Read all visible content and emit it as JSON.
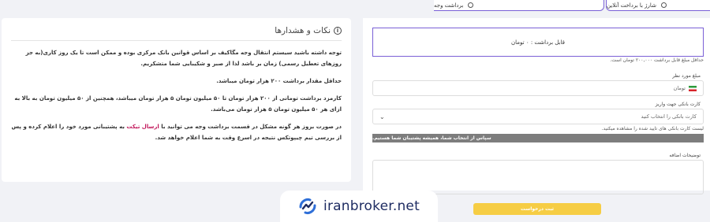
{
  "tabs": {
    "online": "شارژ با برداخت آنلاین",
    "cash": "برداشت وجه"
  },
  "notes": {
    "title": "نکات و هشدارها",
    "p1": "توجه داشته باشید سیستم انتقال وجه مگاکیف بر اساس قوانین بانک مرکزی بوده و ممکن است تا یک روز کاری(به جز روزهای تعطیل رسمی) زمان بر باشد لذا از صبر و شکیبایی شما متشکریم.",
    "p2": "حداقل مقدار برداشت ۲۰۰ هزار تومان میباشد.",
    "p3": "کارمزد برداشت تومانی از ۲۰۰ هزار تومان  تا ۵۰ میلیون تومان ۵ هزار تومان میباشد، همچنین از ۵۰ میلیون تومان به بالا به ازای هر ۵۰ میلیون تومان ۵ هزار تومان می‌باشد.",
    "p4_before": "در صورت بروز هر گونه مشکل در قسمت برداشت وجه می توانید با",
    "p4_ticket": "ارسال تیکت",
    "p4_after": "به پشتیبانی مورد خود را اعلام کرده و پس از بررسی تیم چیپوتکس نتیجه در اسرع وقت به شما اعلام خواهد شد."
  },
  "form": {
    "balance": "قابل برداشت : ۰ تومان",
    "min_hint": "حداقل مبلغ قابل برداشت ۲۰۰,۰۰۰ تومان است.",
    "amount_label": "مبلغ مورد نظر",
    "amount_placeholder": "تومان",
    "card_label": "کارت بانکی جهت واریز",
    "card_placeholder": "کارت بانکی را انتخاب کنید",
    "card_hint": "لیست کارت بانکی های تایید شده را مشاهده میکنید.",
    "alert": "سپاس از انتخاب شما، همیشه پشتیبان شما هستیم.",
    "notes_label": "توضیحات اضافه",
    "submit": "ثبت درخواست"
  },
  "watermark": {
    "text": "iranbroker.net"
  },
  "colors": {
    "accent": "#7a60d6",
    "submit": "#f6cd44",
    "alert": "#7d7d7d",
    "ticket": "#c2185b"
  }
}
